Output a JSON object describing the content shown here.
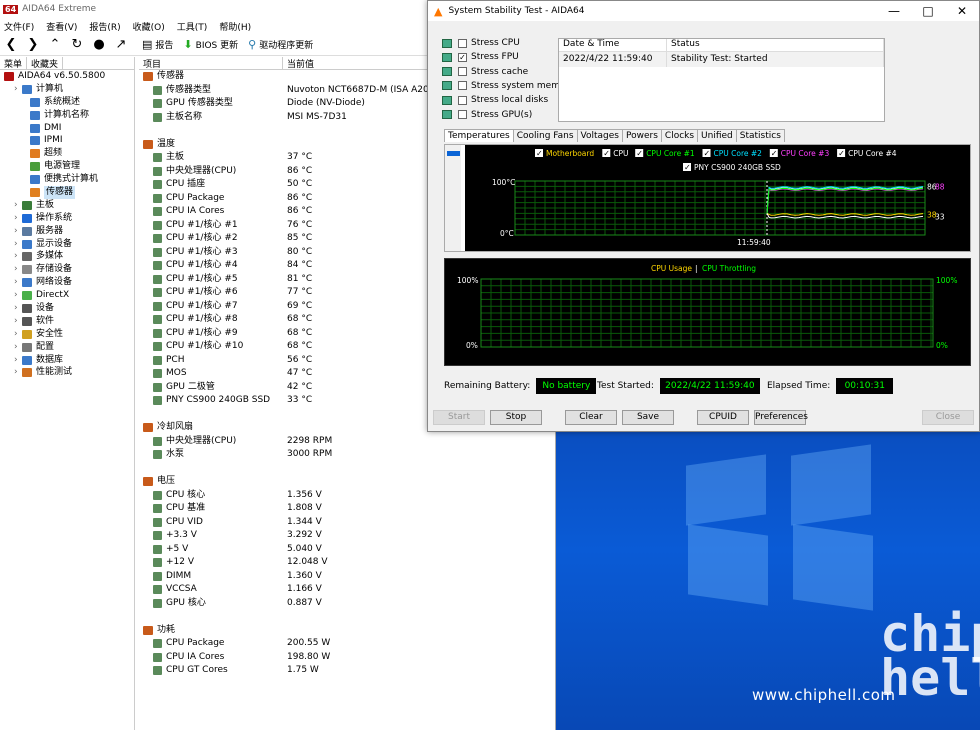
{
  "app": {
    "title": "AIDA64 Extreme",
    "logo": "64"
  },
  "menu": [
    "文件(F)",
    "查看(V)",
    "报告(R)",
    "收藏(O)",
    "工具(T)",
    "帮助(H)"
  ],
  "toolbar": {
    "report": "报告",
    "bios": "BIOS 更新",
    "driver": "驱动程序更新"
  },
  "left_tabs": [
    "菜单",
    "收藏夹"
  ],
  "tree": [
    {
      "label": "AIDA64 v6.50.5800",
      "indent": 0,
      "color": "#b31010"
    },
    {
      "label": "计算机",
      "indent": 1,
      "color": "#3b79c9"
    },
    {
      "label": "系统概述",
      "indent": 2,
      "color": "#3b79c9"
    },
    {
      "label": "计算机名称",
      "indent": 2,
      "color": "#3b79c9"
    },
    {
      "label": "DMI",
      "indent": 2,
      "color": "#3b79c9"
    },
    {
      "label": "IPMI",
      "indent": 2,
      "color": "#3b79c9"
    },
    {
      "label": "超频",
      "indent": 2,
      "color": "#e07b20"
    },
    {
      "label": "电源管理",
      "indent": 2,
      "color": "#4a9d3a"
    },
    {
      "label": "便携式计算机",
      "indent": 2,
      "color": "#3b79c9"
    },
    {
      "label": "传感器",
      "indent": 2,
      "color": "#e08020",
      "selected": true
    },
    {
      "label": "主板",
      "indent": 1,
      "color": "#3a7d3a"
    },
    {
      "label": "操作系统",
      "indent": 1,
      "color": "#1e6ad6"
    },
    {
      "label": "服务器",
      "indent": 1,
      "color": "#5a7aa0"
    },
    {
      "label": "显示设备",
      "indent": 1,
      "color": "#3b79c9"
    },
    {
      "label": "多媒体",
      "indent": 1,
      "color": "#666"
    },
    {
      "label": "存储设备",
      "indent": 1,
      "color": "#888"
    },
    {
      "label": "网络设备",
      "indent": 1,
      "color": "#3b79c9"
    },
    {
      "label": "DirectX",
      "indent": 1,
      "color": "#4ab04a"
    },
    {
      "label": "设备",
      "indent": 1,
      "color": "#555"
    },
    {
      "label": "软件",
      "indent": 1,
      "color": "#555"
    },
    {
      "label": "安全性",
      "indent": 1,
      "color": "#d0a020"
    },
    {
      "label": "配置",
      "indent": 1,
      "color": "#777"
    },
    {
      "label": "数据库",
      "indent": 1,
      "color": "#3b79c9"
    },
    {
      "label": "性能测试",
      "indent": 1,
      "color": "#d07020"
    }
  ],
  "list_header": {
    "item": "项目",
    "value": "当前值"
  },
  "sensor_rows": [
    {
      "name": "传感器",
      "value": "",
      "section": true
    },
    {
      "name": "传感器类型",
      "value": "Nuvoton NCT6687D-M  (ISA A20h)"
    },
    {
      "name": "GPU 传感器类型",
      "value": "Diode  (NV-Diode)"
    },
    {
      "name": "主板名称",
      "value": "MSI MS-7D31"
    },
    {
      "name": "",
      "value": "",
      "gap": true
    },
    {
      "name": "温度",
      "value": "",
      "section": true
    },
    {
      "name": "主板",
      "value": "37 °C"
    },
    {
      "name": "中央处理器(CPU)",
      "value": "86 °C"
    },
    {
      "name": "CPU 插座",
      "value": "50 °C"
    },
    {
      "name": "CPU Package",
      "value": "86 °C"
    },
    {
      "name": "CPU IA Cores",
      "value": "86 °C"
    },
    {
      "name": "CPU #1/核心 #1",
      "value": "76 °C"
    },
    {
      "name": "CPU #1/核心 #2",
      "value": "85 °C"
    },
    {
      "name": "CPU #1/核心 #3",
      "value": "80 °C"
    },
    {
      "name": "CPU #1/核心 #4",
      "value": "84 °C"
    },
    {
      "name": "CPU #1/核心 #5",
      "value": "81 °C"
    },
    {
      "name": "CPU #1/核心 #6",
      "value": "77 °C"
    },
    {
      "name": "CPU #1/核心 #7",
      "value": "69 °C"
    },
    {
      "name": "CPU #1/核心 #8",
      "value": "68 °C"
    },
    {
      "name": "CPU #1/核心 #9",
      "value": "68 °C"
    },
    {
      "name": "CPU #1/核心 #10",
      "value": "68 °C"
    },
    {
      "name": "PCH",
      "value": "56 °C"
    },
    {
      "name": "MOS",
      "value": "47 °C"
    },
    {
      "name": "GPU 二极管",
      "value": "42 °C"
    },
    {
      "name": "PNY CS900 240GB SSD",
      "value": "33 °C"
    },
    {
      "name": "",
      "value": "",
      "gap": true
    },
    {
      "name": "冷却风扇",
      "value": "",
      "section": true
    },
    {
      "name": "中央处理器(CPU)",
      "value": "2298 RPM"
    },
    {
      "name": "水泵",
      "value": "3000 RPM"
    },
    {
      "name": "",
      "value": "",
      "gap": true
    },
    {
      "name": "电压",
      "value": "",
      "section": true
    },
    {
      "name": "CPU 核心",
      "value": "1.356 V"
    },
    {
      "name": "CPU 基准",
      "value": "1.808 V"
    },
    {
      "name": "CPU VID",
      "value": "1.344 V"
    },
    {
      "name": "+3.3 V",
      "value": "3.292 V"
    },
    {
      "name": "+5 V",
      "value": "5.040 V"
    },
    {
      "name": "+12 V",
      "value": "12.048 V"
    },
    {
      "name": "DIMM",
      "value": "1.360 V"
    },
    {
      "name": "VCCSA",
      "value": "1.166 V"
    },
    {
      "name": "GPU 核心",
      "value": "0.887 V"
    },
    {
      "name": "",
      "value": "",
      "gap": true
    },
    {
      "name": "功耗",
      "value": "",
      "section": true
    },
    {
      "name": "CPU Package",
      "value": "200.55 W"
    },
    {
      "name": "CPU IA Cores",
      "value": "198.80 W"
    },
    {
      "name": "CPU GT Cores",
      "value": "1.75 W"
    }
  ],
  "dialog": {
    "title": "System Stability Test - AIDA64",
    "stress": [
      {
        "label": "Stress CPU",
        "checked": false
      },
      {
        "label": "Stress FPU",
        "checked": true
      },
      {
        "label": "Stress cache",
        "checked": false
      },
      {
        "label": "Stress system memory",
        "checked": false
      },
      {
        "label": "Stress local disks",
        "checked": false
      },
      {
        "label": "Stress GPU(s)",
        "checked": false
      }
    ],
    "log_header": {
      "date": "Date & Time",
      "status": "Status"
    },
    "log_rows": [
      {
        "date": "2022/4/22 11:59:40",
        "status": "Stability Test: Started"
      }
    ],
    "tabs": [
      "Temperatures",
      "Cooling Fans",
      "Voltages",
      "Powers",
      "Clocks",
      "Unified",
      "Statistics"
    ],
    "temp_legend": [
      {
        "label": "Motherboard",
        "color": "#ffd700"
      },
      {
        "label": "CPU",
        "color": "#ffffff"
      },
      {
        "label": "CPU Core #1",
        "color": "#00ff00"
      },
      {
        "label": "CPU Core #2",
        "color": "#00e0ff"
      },
      {
        "label": "CPU Core #3",
        "color": "#ff40ff"
      },
      {
        "label": "CPU Core #4",
        "color": "#ffffff"
      },
      {
        "label": "PNY CS900 240GB SSD",
        "color": "#ffffff"
      }
    ],
    "temp_axis": {
      "top": "100°C",
      "bottom": "0°C",
      "time": "11:59:40"
    },
    "temp_right_labels": {
      "hi": "86",
      "hi2": "88",
      "lo": "38",
      "lo2": "33"
    },
    "usage_legend": {
      "usage": "CPU Usage",
      "sep": "|",
      "throttle": "CPU Throttling"
    },
    "usage_axis": {
      "top_left": "100%",
      "bottom_left": "0%",
      "top_right": "100%",
      "bottom_right": "0%"
    },
    "status": {
      "battery_label": "Remaining Battery:",
      "battery": "No battery",
      "started_label": "Test Started:",
      "started": "2022/4/22 11:59:40",
      "elapsed_label": "Elapsed Time:",
      "elapsed": "00:10:31"
    },
    "buttons": {
      "start": "Start",
      "stop": "Stop",
      "clear": "Clear",
      "save": "Save",
      "cpuid": "CPUID",
      "prefs": "Preferences",
      "close": "Close"
    }
  },
  "watermark": {
    "site": "www.chiphell.com",
    "logo": "chip hell"
  }
}
